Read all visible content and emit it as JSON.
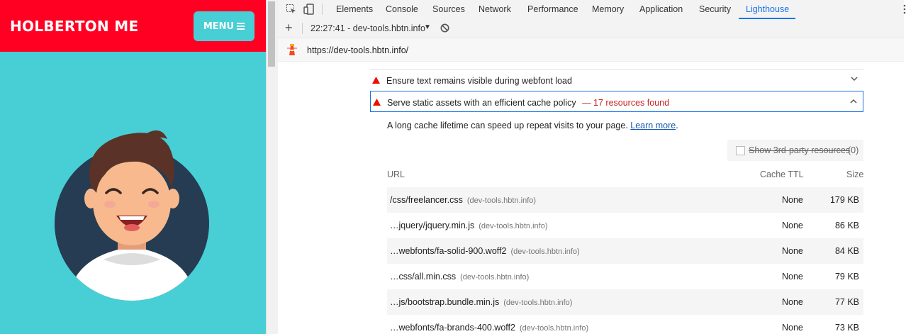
{
  "site": {
    "brand": "HOLBERTON ME",
    "menu_label": "MENU"
  },
  "devtools": {
    "tabs": [
      "Elements",
      "Console",
      "Sources",
      "Network",
      "Performance",
      "Memory",
      "Application",
      "Security",
      "Lighthouse"
    ],
    "active_tab": "Lighthouse",
    "session": "22:27:41 - dev-tools.hbtn.info",
    "url": "https://dev-tools.hbtn.info/"
  },
  "audits": {
    "webfont": "Ensure text remains visible during webfont load",
    "cache_title": "Serve static assets with an efficient cache policy",
    "cache_found": "— 17 resources found",
    "description": "A long cache lifetime can speed up repeat visits to your page.",
    "learn_more": "Learn more",
    "third_party_label": "Show 3rd-party resources",
    "third_party_count": "(0)"
  },
  "table": {
    "headers": {
      "url": "URL",
      "ttl": "Cache TTL",
      "size": "Size"
    },
    "rows": [
      {
        "url": "/css/freelancer.css",
        "host": "(dev-tools.hbtn.info)",
        "ttl": "None",
        "size": "179 KB"
      },
      {
        "url": "…jquery/jquery.min.js",
        "host": "(dev-tools.hbtn.info)",
        "ttl": "None",
        "size": "86 KB"
      },
      {
        "url": "…webfonts/fa-solid-900.woff2",
        "host": "(dev-tools.hbtn.info)",
        "ttl": "None",
        "size": "84 KB"
      },
      {
        "url": "…css/all.min.css",
        "host": "(dev-tools.hbtn.info)",
        "ttl": "None",
        "size": "79 KB"
      },
      {
        "url": "…js/bootstrap.bundle.min.js",
        "host": "(dev-tools.hbtn.info)",
        "ttl": "None",
        "size": "77 KB"
      },
      {
        "url": "…webfonts/fa-brands-400.woff2",
        "host": "(dev-tools.hbtn.info)",
        "ttl": "None",
        "size": "73 KB"
      }
    ]
  },
  "colors": {
    "brand_red": "#ff0022",
    "teal": "#48cfd5",
    "accent_blue": "#1a73e8",
    "warn_red": "#c5221f"
  }
}
